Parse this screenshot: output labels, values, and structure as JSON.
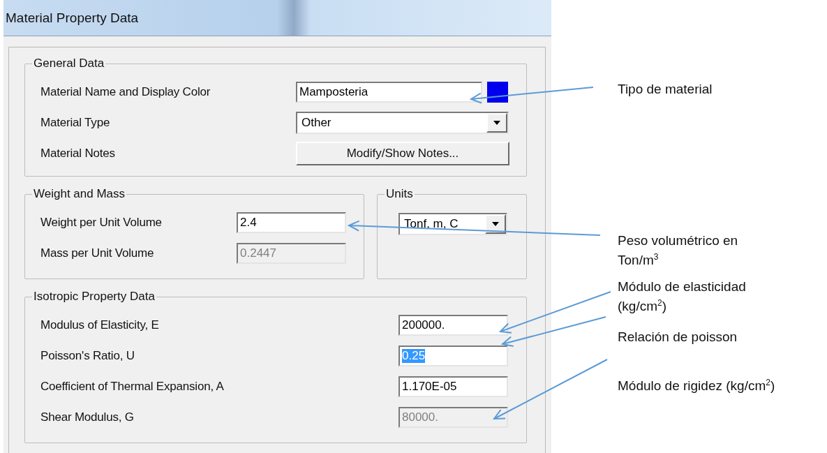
{
  "window": {
    "title": "Material Property Data"
  },
  "general_data": {
    "title": "General Data",
    "rows": [
      {
        "kind": "text",
        "label": "Material Name and Display Color",
        "value": "Mamposteria",
        "color": "#0000ee"
      },
      {
        "kind": "combo",
        "label": "Material Type",
        "value": "Other"
      },
      {
        "kind": "button",
        "label": "Material Notes",
        "value": "Modify/Show Notes..."
      }
    ]
  },
  "weight_and_mass": {
    "title": "Weight and Mass",
    "rows": [
      {
        "kind": "text",
        "label": "Weight per Unit Volume",
        "value": "2.4",
        "disabled": false,
        "selected": false
      },
      {
        "kind": "text",
        "label": "Mass per Unit Volume",
        "value": "0.2447",
        "disabled": true,
        "selected": false
      }
    ]
  },
  "units": {
    "title": "Units",
    "value": "Tonf, m, C"
  },
  "isotropic_property_data": {
    "title": "Isotropic Property Data",
    "rows": [
      {
        "kind": "text",
        "label": "Modulus of Elasticity,  E",
        "value": "200000.",
        "disabled": false,
        "selected": false
      },
      {
        "kind": "text",
        "label": "Poisson's Ratio,  U",
        "value": "0.25",
        "disabled": false,
        "selected": true
      },
      {
        "kind": "text",
        "label": "Coefficient of Thermal Expansion,  A",
        "value": "1.170E-05",
        "disabled": false,
        "selected": false
      },
      {
        "kind": "text",
        "label": "Shear Modulus,  G",
        "value": "80000.",
        "disabled": true,
        "selected": false
      }
    ]
  },
  "annotations": [
    {
      "lines": [
        "Tipo de material"
      ]
    },
    {
      "lines": [
        "Peso volumétrico en",
        "Ton/m$^{3}$"
      ]
    },
    {
      "lines": [
        "Módulo de elasticidad",
        "(kg/cm$^{2}$)"
      ]
    },
    {
      "lines": [
        "Relación de poisson"
      ]
    },
    {
      "lines": [
        "Módulo de rigidez (kg/cm$^{2}$)"
      ]
    }
  ]
}
